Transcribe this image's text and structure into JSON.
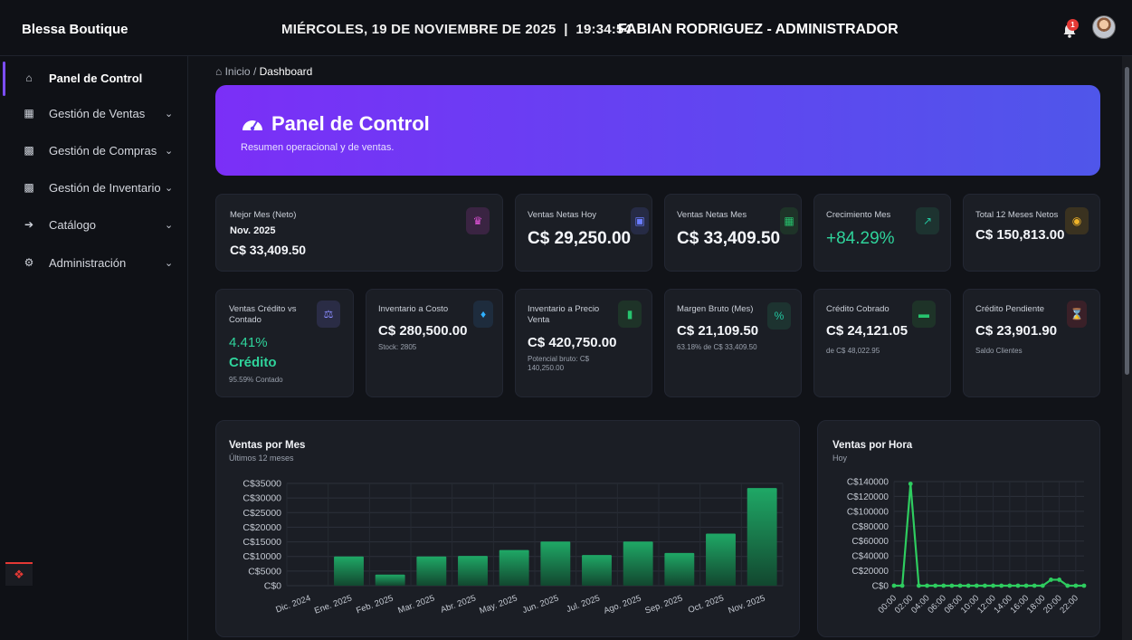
{
  "header": {
    "brand": "Blessa Boutique",
    "datetime": "MIÉRCOLES, 19 DE NOVIEMBRE DE 2025  |  19:34:54",
    "user": "FABIAN RODRIGUEZ - ADMINISTRADOR",
    "notifications": "1"
  },
  "sidebar": {
    "items": [
      {
        "label": "Panel de Control",
        "icon": "home-icon"
      },
      {
        "label": "Gestión de Ventas",
        "icon": "sales-icon"
      },
      {
        "label": "Gestión de Compras",
        "icon": "purchases-icon"
      },
      {
        "label": "Gestión de Inventario",
        "icon": "inventory-icon"
      },
      {
        "label": "Catálogo",
        "icon": "catalog-icon"
      },
      {
        "label": "Administración",
        "icon": "admin-icon"
      }
    ]
  },
  "breadcrumb": {
    "home": "Inicio",
    "sep": "/",
    "current": "Dashboard"
  },
  "hero": {
    "title": "Panel de Control",
    "subtitle": "Resumen operacional y de ventas."
  },
  "cards_row1": [
    {
      "label": "Mejor Mes (Neto)",
      "line1": "Nov. 2025",
      "value": "C$ 33,409.50",
      "icon": "trophy-icon",
      "color": "#e052d8"
    },
    {
      "label": "Ventas Netas Hoy",
      "value": "C$ 29,250.00",
      "icon": "calendar-day-icon",
      "color": "#6a7dff"
    },
    {
      "label": "Ventas Netas Mes",
      "value": "C$ 33,409.50",
      "icon": "calendar-icon",
      "color": "#27c46e"
    },
    {
      "label": "Crecimiento Mes",
      "value": "+84.29%",
      "icon": "chart-line-icon",
      "color": "#22c7a0"
    },
    {
      "label": "Total 12 Meses Netos",
      "value": "C$ 150,813.00",
      "icon": "coins-icon",
      "color": "#f0b429"
    }
  ],
  "cards_row2": [
    {
      "label": "Ventas Crédito vs Contado",
      "value": "4.41%",
      "value2": "Crédito",
      "sub": "95.59% Contado",
      "icon": "scale-icon",
      "color": "#8a8cff"
    },
    {
      "label": "Inventario a Costo",
      "value": "C$ 280,500.00",
      "sub": "Stock: 2805",
      "icon": "layers-icon",
      "color": "#2fb0ff"
    },
    {
      "label": "Inventario a Precio Venta",
      "value": "C$ 420,750.00",
      "sub": "Potencial bruto: C$ 140,250.00",
      "icon": "chart-bar-icon",
      "color": "#27c46e"
    },
    {
      "label": "Margen Bruto (Mes)",
      "value": "C$ 21,109.50",
      "sub": "63.18% de C$ 33,409.50",
      "icon": "percent-icon",
      "color": "#22c7a0"
    },
    {
      "label": "Crédito Cobrado",
      "value": "C$ 24,121.05",
      "sub": "de C$ 48,022.95",
      "icon": "money-icon",
      "color": "#27c46e"
    },
    {
      "label": "Crédito Pendiente",
      "value": "C$ 23,901.90",
      "sub": "Saldo Clientes",
      "icon": "hourglass-icon",
      "color": "#ff4d6d"
    }
  ],
  "chart_data": [
    {
      "type": "bar",
      "title": "Ventas por Mes",
      "subtitle": "Últimos 12 meses",
      "categories": [
        "Dic. 2024",
        "Ene. 2025",
        "Feb. 2025",
        "Mar. 2025",
        "Abr. 2025",
        "May. 2025",
        "Jun. 2025",
        "Jul. 2025",
        "Ago. 2025",
        "Sep. 2025",
        "Oct. 2025",
        "Nov. 2025"
      ],
      "values": [
        0,
        10000,
        3800,
        10000,
        10200,
        12200,
        15100,
        10500,
        15100,
        11200,
        17800,
        33409.5
      ],
      "yticks": [
        "C$35000",
        "C$30000",
        "C$25000",
        "C$20000",
        "C$15000",
        "C$10000",
        "C$5000",
        "C$0"
      ],
      "ylim": [
        0,
        35000
      ],
      "grid": true,
      "color": "#1f8f5a"
    },
    {
      "type": "line",
      "title": "Ventas por Hora",
      "subtitle": "Hoy",
      "x": [
        "00:00",
        "01:00",
        "02:00",
        "03:00",
        "04:00",
        "05:00",
        "06:00",
        "07:00",
        "08:00",
        "09:00",
        "10:00",
        "11:00",
        "12:00",
        "13:00",
        "14:00",
        "15:00",
        "16:00",
        "17:00",
        "18:00",
        "19:00",
        "20:00",
        "21:00",
        "22:00",
        "23:00"
      ],
      "xticks": [
        "00:00",
        "02:00",
        "04:00",
        "06:00",
        "08:00",
        "10:00",
        "12:00",
        "14:00",
        "16:00",
        "18:00",
        "20:00",
        "22:00"
      ],
      "values": [
        0,
        0,
        137000,
        0,
        0,
        0,
        0,
        0,
        0,
        0,
        0,
        0,
        0,
        0,
        0,
        0,
        0,
        0,
        0,
        8000,
        8000,
        0,
        0,
        0
      ],
      "yticks": [
        "C$140000",
        "C$120000",
        "C$100000",
        "C$80000",
        "C$60000",
        "C$40000",
        "C$20000",
        "C$0"
      ],
      "ylim": [
        0,
        140000
      ],
      "grid": true,
      "color": "#2ecc5f"
    }
  ]
}
